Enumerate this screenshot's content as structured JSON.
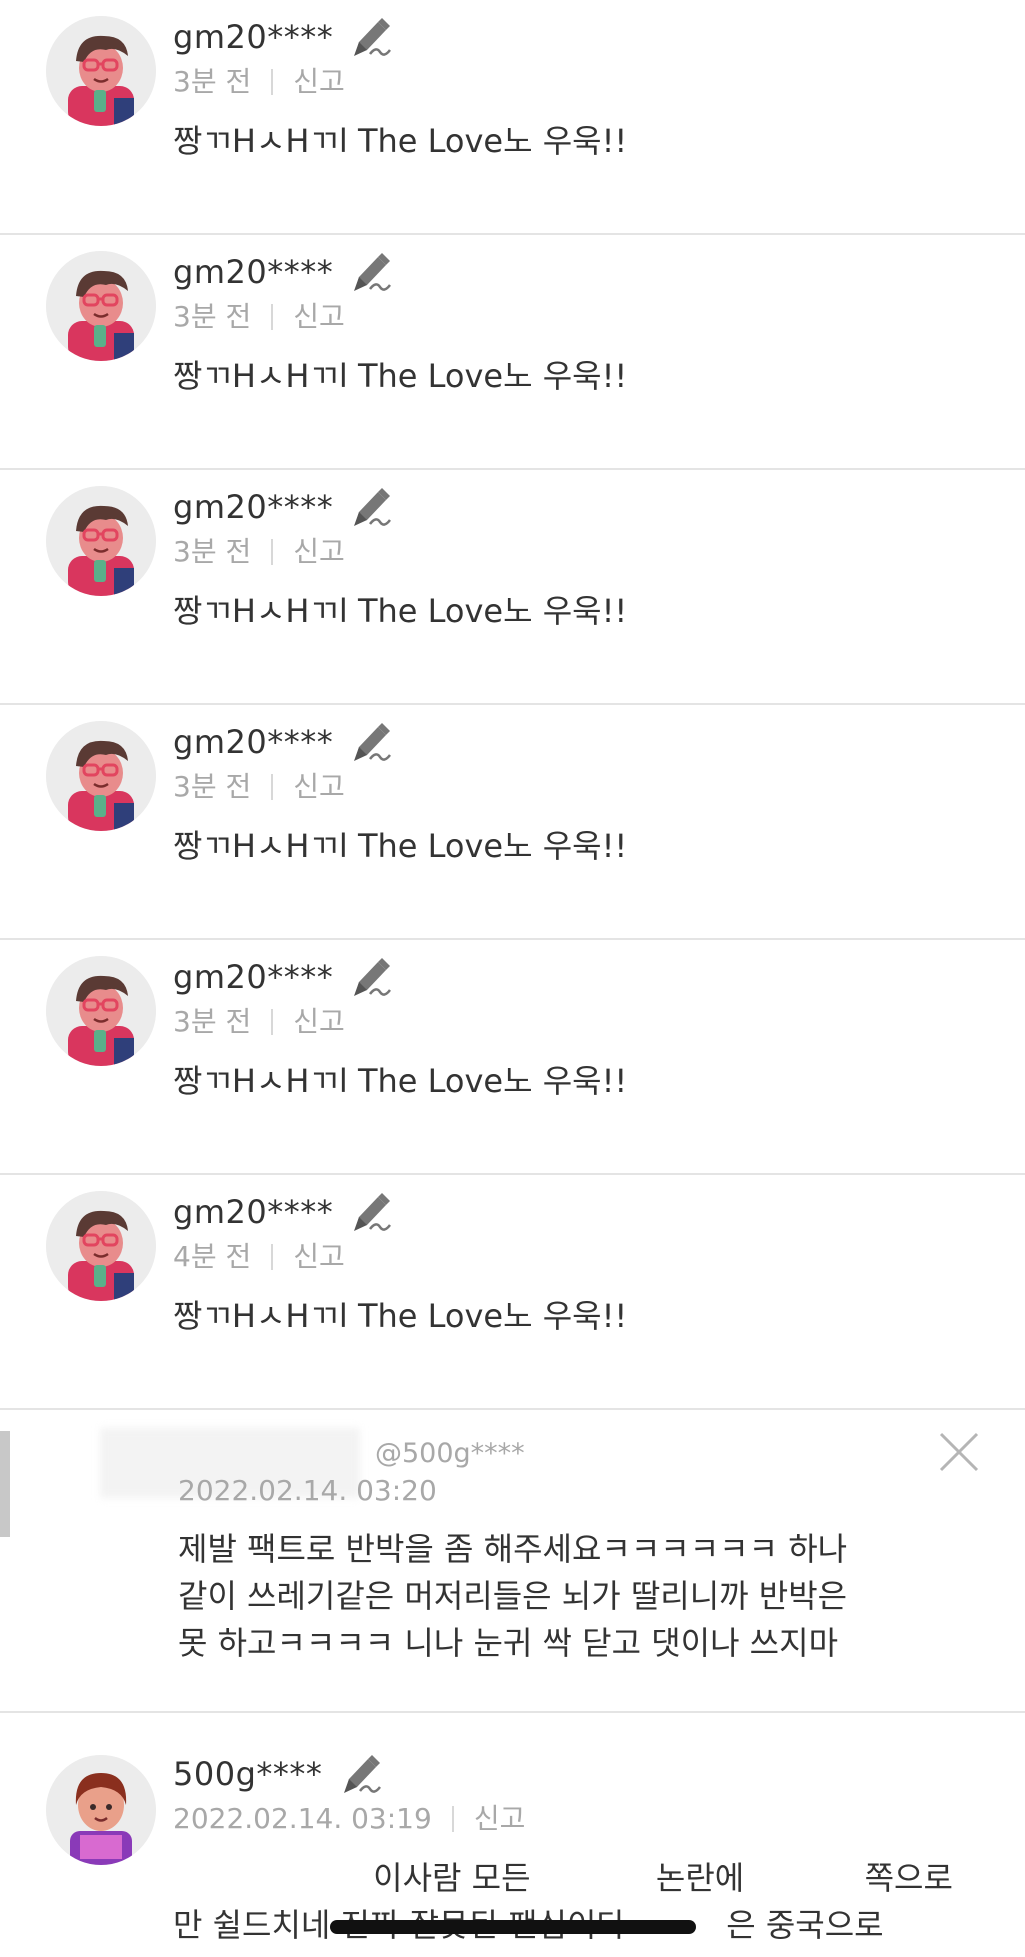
{
  "comments": [
    {
      "username": "gm20****",
      "time": "3분 전",
      "report": "신고",
      "text": "짱ㄲHㅅHㄲl The Love노 우욱!!"
    },
    {
      "username": "gm20****",
      "time": "3분 전",
      "report": "신고",
      "text": "짱ㄲHㅅHㄲl The Love노 우욱!!"
    },
    {
      "username": "gm20****",
      "time": "3분 전",
      "report": "신고",
      "text": "짱ㄲHㅅHㄲl The Love노 우욱!!"
    },
    {
      "username": "gm20****",
      "time": "3분 전",
      "report": "신고",
      "text": "짱ㄲHㅅHㄲl The Love노 우욱!!"
    },
    {
      "username": "gm20****",
      "time": "3분 전",
      "report": "신고",
      "text": "짱ㄲHㅅHㄲl The Love노 우욱!!"
    },
    {
      "username": "gm20****",
      "time": "4분 전",
      "report": "신고",
      "text": "짱ㄲHㅅHㄲl The Love노 우욱!!"
    }
  ],
  "reply": {
    "mention": "@500g****",
    "date": "2022.02.14. 03:20",
    "lines": [
      "제발 팩트로 반박을 좀 해주세요ㅋㅋㅋㅋㅋㅋ 하나",
      "같이 쓰레기같은 머저리들은 뇌가 딸리니까 반박은",
      "못 하고ㅋㅋㅋㅋ 니나 눈귀 싹 닫고 댓이나 쓰지마"
    ]
  },
  "last_comment": {
    "username": "500g****",
    "date": "2022.02.14. 03:19",
    "report": "신고",
    "line1_a": "이사람 모든",
    "line1_b": "논란에",
    "line1_c": "쪽으로",
    "line2_a": "만 쉴드치네",
    "line2_b": "진짜 잘못된 팬심이다",
    "line2_c": "은 중국으로"
  },
  "icons": {
    "edit": "pencil-icon",
    "close": "close-icon"
  }
}
